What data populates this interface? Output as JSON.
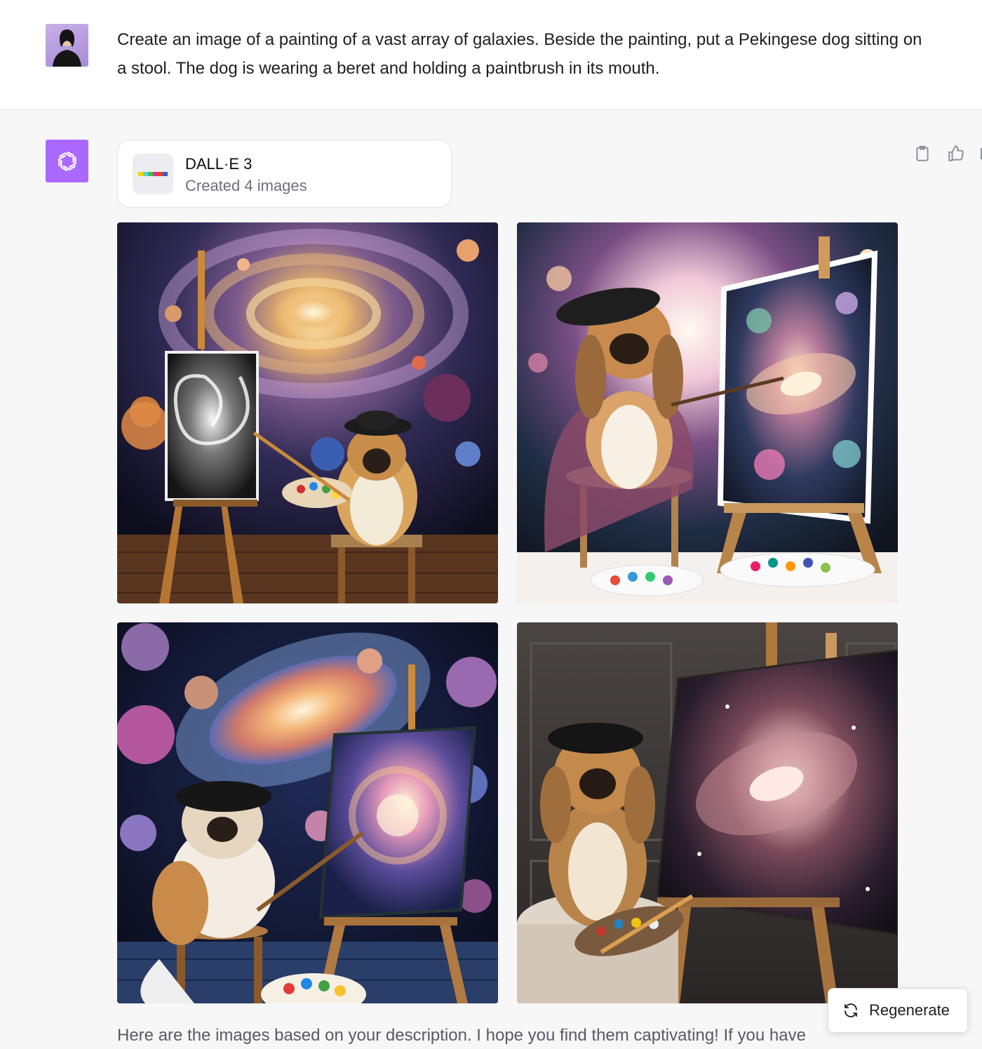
{
  "user_message": {
    "text": "Create an image of a painting of a vast array of galaxies. Beside the painting, put a Pekingese dog sitting on a stool. The dog is wearing a beret and holding a paintbrush in its mouth."
  },
  "assistant": {
    "tool": {
      "name": "DALL·E 3",
      "status": "Created 4 images"
    },
    "images": [
      {
        "icon": "galaxy-painting-dog-image"
      },
      {
        "icon": "galaxy-painting-dog-image"
      },
      {
        "icon": "galaxy-painting-dog-image"
      },
      {
        "icon": "galaxy-painting-dog-image"
      }
    ],
    "reply_text": "Here are the images based on your description. I hope you find them captivating! If you have",
    "regenerate_label": "Regenerate"
  },
  "colors": {
    "assistant_avatar_bg": "#ab68ff",
    "assistant_row_bg": "#f7f7f8",
    "user_row_bg": "#ffffff"
  }
}
